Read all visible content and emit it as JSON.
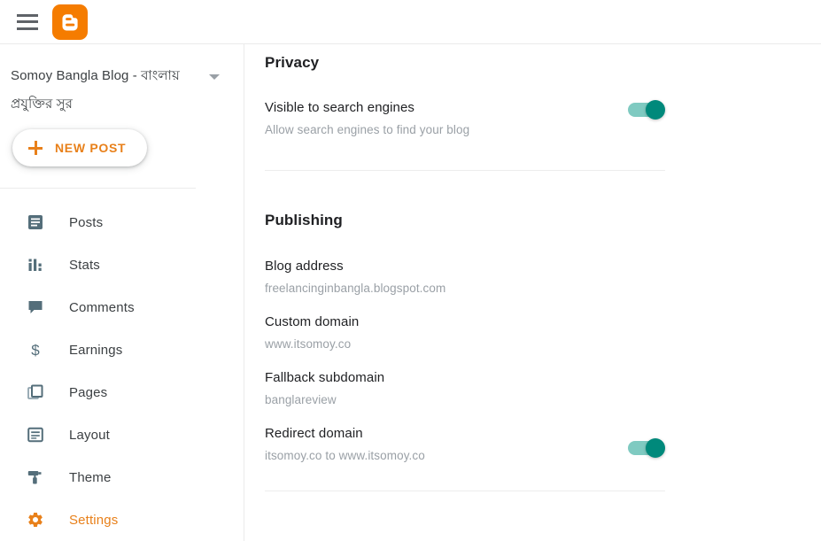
{
  "topbar": {
    "menu_icon": "hamburger-menu-icon",
    "logo_icon": "blogger-logo-icon"
  },
  "sidebar": {
    "blog_title": "Somoy Bangla Blog - বাংলায় প্রযুক্তির সুর",
    "blog_selector_caret": "chevron-down-icon",
    "new_post_label": "NEW POST",
    "new_post_icon": "plus-icon",
    "items": [
      {
        "label": "Posts",
        "icon": "posts-icon",
        "active": false
      },
      {
        "label": "Stats",
        "icon": "stats-icon",
        "active": false
      },
      {
        "label": "Comments",
        "icon": "comments-icon",
        "active": false
      },
      {
        "label": "Earnings",
        "icon": "earnings-icon",
        "active": false
      },
      {
        "label": "Pages",
        "icon": "pages-icon",
        "active": false
      },
      {
        "label": "Layout",
        "icon": "layout-icon",
        "active": false
      },
      {
        "label": "Theme",
        "icon": "theme-icon",
        "active": false
      },
      {
        "label": "Settings",
        "icon": "settings-gear-icon",
        "active": true
      }
    ]
  },
  "content": {
    "privacy": {
      "heading": "Privacy",
      "rows": [
        {
          "primary": "Visible to search engines",
          "secondary": "Allow search engines to find your blog",
          "toggle": "on"
        }
      ]
    },
    "publishing": {
      "heading": "Publishing",
      "rows": [
        {
          "primary": "Blog address",
          "secondary": "freelancinginbangla.blogspot.com",
          "toggle": "none"
        },
        {
          "primary": "Custom domain",
          "secondary": "www.itsomoy.co",
          "toggle": "none"
        },
        {
          "primary": "Fallback subdomain",
          "secondary": "banglareview",
          "toggle": "none"
        },
        {
          "primary": "Redirect domain",
          "secondary": "itsomoy.co to www.itsomoy.co",
          "toggle": "on"
        }
      ]
    }
  },
  "colors": {
    "accent_orange": "#e8801a",
    "logo_orange": "#f57c00",
    "toggle_thumb": "#00897b",
    "toggle_track": "#7fcac1",
    "icon_gray": "#546e7a",
    "text_primary": "#202124",
    "text_secondary": "#9aa0a6"
  }
}
